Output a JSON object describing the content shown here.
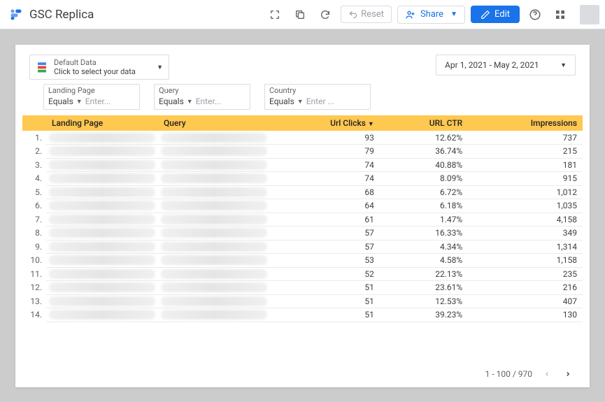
{
  "header": {
    "title": "GSC Replica",
    "reset_label": "Reset",
    "share_label": "Share",
    "edit_label": "Edit"
  },
  "controls": {
    "data_selector": {
      "line1": "Default Data",
      "line2": "Click to select your data"
    },
    "date_range": "Apr 1, 2021 - May 2, 2021",
    "filters": [
      {
        "label": "Landing Page",
        "operator": "Equals",
        "placeholder": "Enter..."
      },
      {
        "label": "Query",
        "operator": "Equals",
        "placeholder": "Enter..."
      },
      {
        "label": "Country",
        "operator": "Equals",
        "placeholder": "Enter ..."
      }
    ]
  },
  "table": {
    "columns": [
      "Landing Page",
      "Query",
      "Url Clicks",
      "URL CTR",
      "Impressions"
    ],
    "sort_column": "Url Clicks",
    "rows": [
      {
        "idx": 1,
        "clicks": "93",
        "ctr": "12.62%",
        "impressions": "737"
      },
      {
        "idx": 2,
        "clicks": "79",
        "ctr": "36.74%",
        "impressions": "215"
      },
      {
        "idx": 3,
        "clicks": "74",
        "ctr": "40.88%",
        "impressions": "181"
      },
      {
        "idx": 4,
        "clicks": "74",
        "ctr": "8.09%",
        "impressions": "915"
      },
      {
        "idx": 5,
        "clicks": "68",
        "ctr": "6.72%",
        "impressions": "1,012"
      },
      {
        "idx": 6,
        "clicks": "64",
        "ctr": "6.18%",
        "impressions": "1,035"
      },
      {
        "idx": 7,
        "clicks": "61",
        "ctr": "1.47%",
        "impressions": "4,158"
      },
      {
        "idx": 8,
        "clicks": "57",
        "ctr": "16.33%",
        "impressions": "349"
      },
      {
        "idx": 9,
        "clicks": "57",
        "ctr": "4.34%",
        "impressions": "1,314"
      },
      {
        "idx": 10,
        "clicks": "53",
        "ctr": "4.58%",
        "impressions": "1,158"
      },
      {
        "idx": 11,
        "clicks": "52",
        "ctr": "22.13%",
        "impressions": "235"
      },
      {
        "idx": 12,
        "clicks": "51",
        "ctr": "23.61%",
        "impressions": "216"
      },
      {
        "idx": 13,
        "clicks": "51",
        "ctr": "12.53%",
        "impressions": "407"
      },
      {
        "idx": 14,
        "clicks": "51",
        "ctr": "39.23%",
        "impressions": "130"
      }
    ],
    "pager": "1 - 100 / 970"
  }
}
